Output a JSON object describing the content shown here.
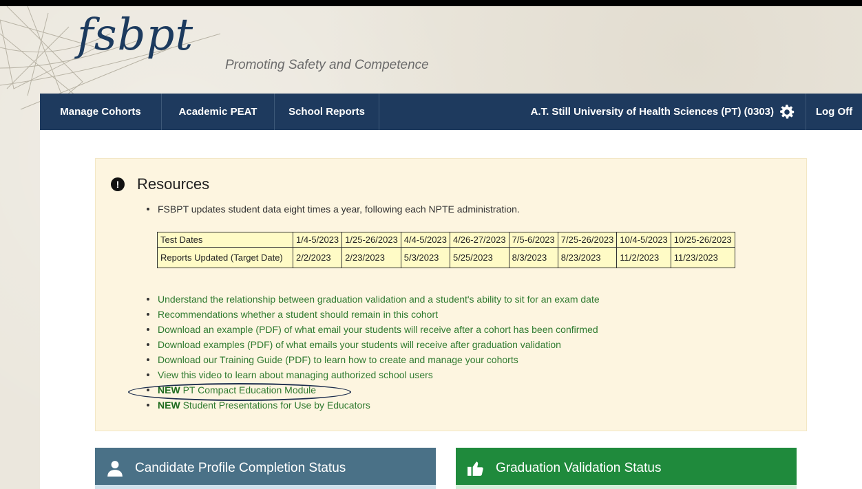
{
  "brand": {
    "logo_text": "fsbpt",
    "tagline": "Promoting Safety and Competence"
  },
  "nav": {
    "manage_cohorts": "Manage Cohorts",
    "academic_peat": "Academic PEAT",
    "school_reports": "School Reports",
    "institution": "A.T. Still University of Health Sciences (PT) (0303)",
    "log_off": "Log Off"
  },
  "resources": {
    "title": "Resources",
    "intro": "FSBPT updates student data eight times a year, following each NPTE administration.",
    "table": {
      "row1_label": "Test Dates",
      "test_dates": [
        "1/4-5/2023",
        "1/25-26/2023",
        "4/4-5/2023",
        "4/26-27/2023",
        "7/5-6/2023",
        "7/25-26/2023",
        "10/4-5/2023",
        "10/25-26/2023"
      ],
      "row2_label": "Reports Updated (Target Date)",
      "report_dates": [
        "2/2/2023",
        "2/23/2023",
        "5/3/2023",
        "5/25/2023",
        "8/3/2023",
        "8/23/2023",
        "11/2/2023",
        "11/23/2023"
      ]
    },
    "links": [
      "Understand the relationship between graduation validation and a student's ability to sit for an exam date",
      "Recommendations whether a student should remain in this cohort",
      "Download an example (PDF) of what email your students will receive after a cohort has been confirmed",
      "Download examples (PDF) of what emails your students will receive after graduation validation",
      "Download our Training Guide (PDF) to learn how to create and manage your cohorts",
      "View this video to learn about managing authorized school users"
    ],
    "new_tag": "NEW",
    "new_links": [
      "PT Compact Education Module",
      "Student Presentations for Use by Educators"
    ]
  },
  "panels": {
    "candidate": "Candidate Profile Completion Status",
    "graduation": "Graduation Validation Status"
  },
  "colors": {
    "nav": "#1e3a5e",
    "link": "#2f7a2f",
    "panel_blue": "#4a7187",
    "panel_green": "#1f8a3c"
  }
}
